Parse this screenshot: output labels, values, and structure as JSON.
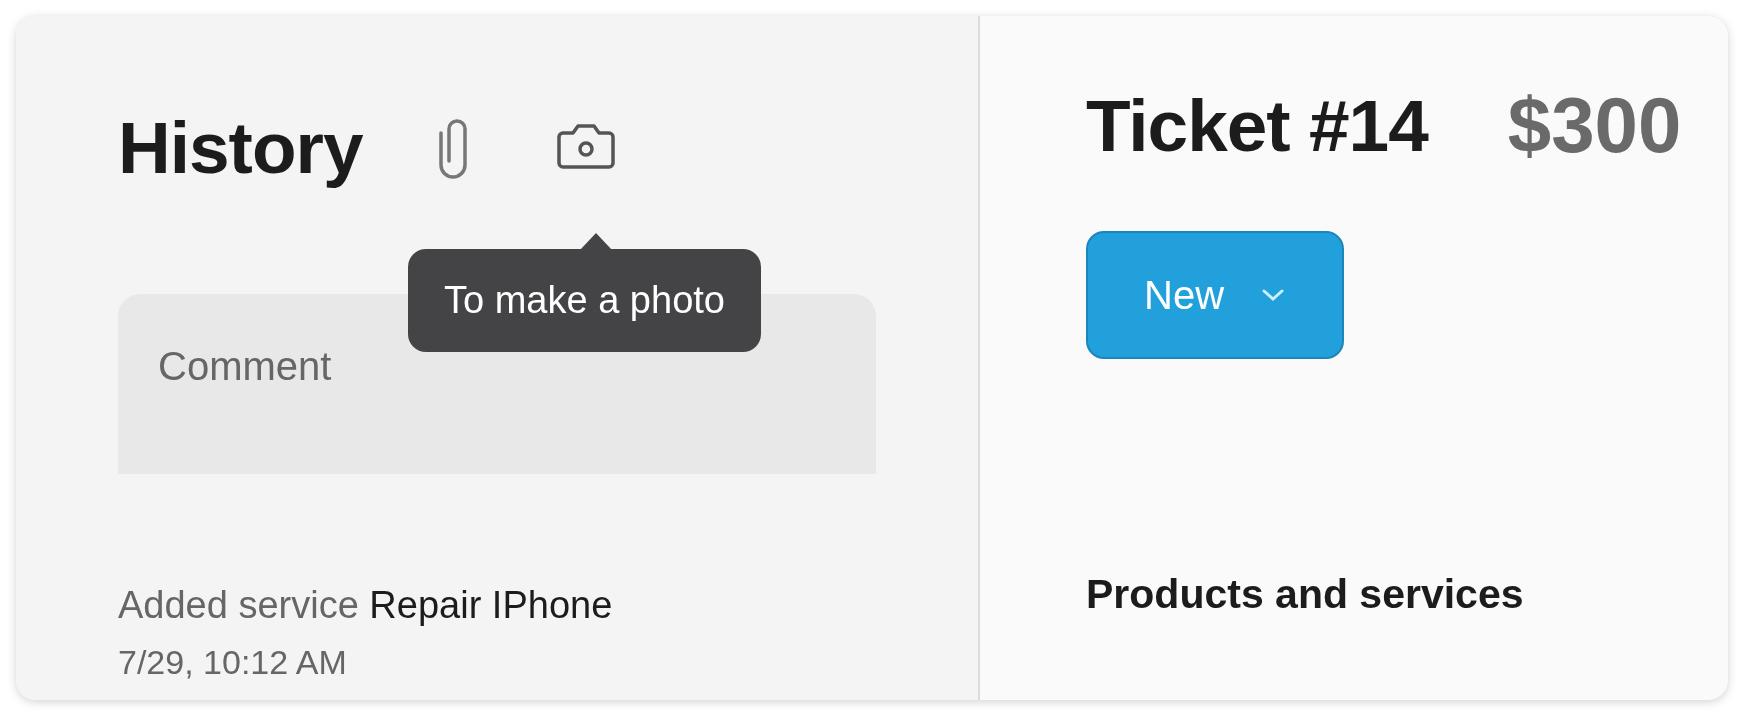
{
  "history": {
    "title": "History",
    "tooltip": "To make a photo",
    "comment": {
      "placeholder": "Comment"
    },
    "events": [
      {
        "action": "Added service",
        "subject": "Repair IPhone",
        "time": "7/29, 10:12 AM"
      }
    ]
  },
  "ticket": {
    "title": "Ticket #14",
    "amount": "$300",
    "status": {
      "label": "New"
    },
    "section": "Products and services"
  }
}
